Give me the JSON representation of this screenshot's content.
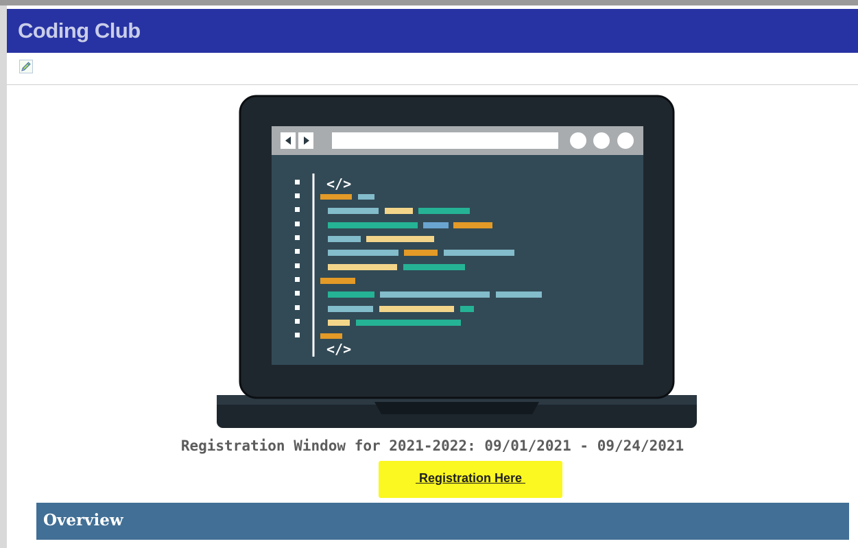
{
  "header": {
    "title": "Coding Club"
  },
  "toolbar": {
    "edit_icon": "pencil-icon"
  },
  "illustration": {
    "icon": "laptop-code-illustration",
    "code_open_tag": "</>",
    "code_close_tag": "</>"
  },
  "registration": {
    "window_text": "Registration Window for 2021-2022: 09/01/2021 - 09/24/2021",
    "link_label": " Registration Here ",
    "highlight_color": "#fbf720"
  },
  "overview": {
    "title": "Overview"
  },
  "colors": {
    "header_bg": "#2733a3",
    "overview_bg": "#426f95"
  }
}
